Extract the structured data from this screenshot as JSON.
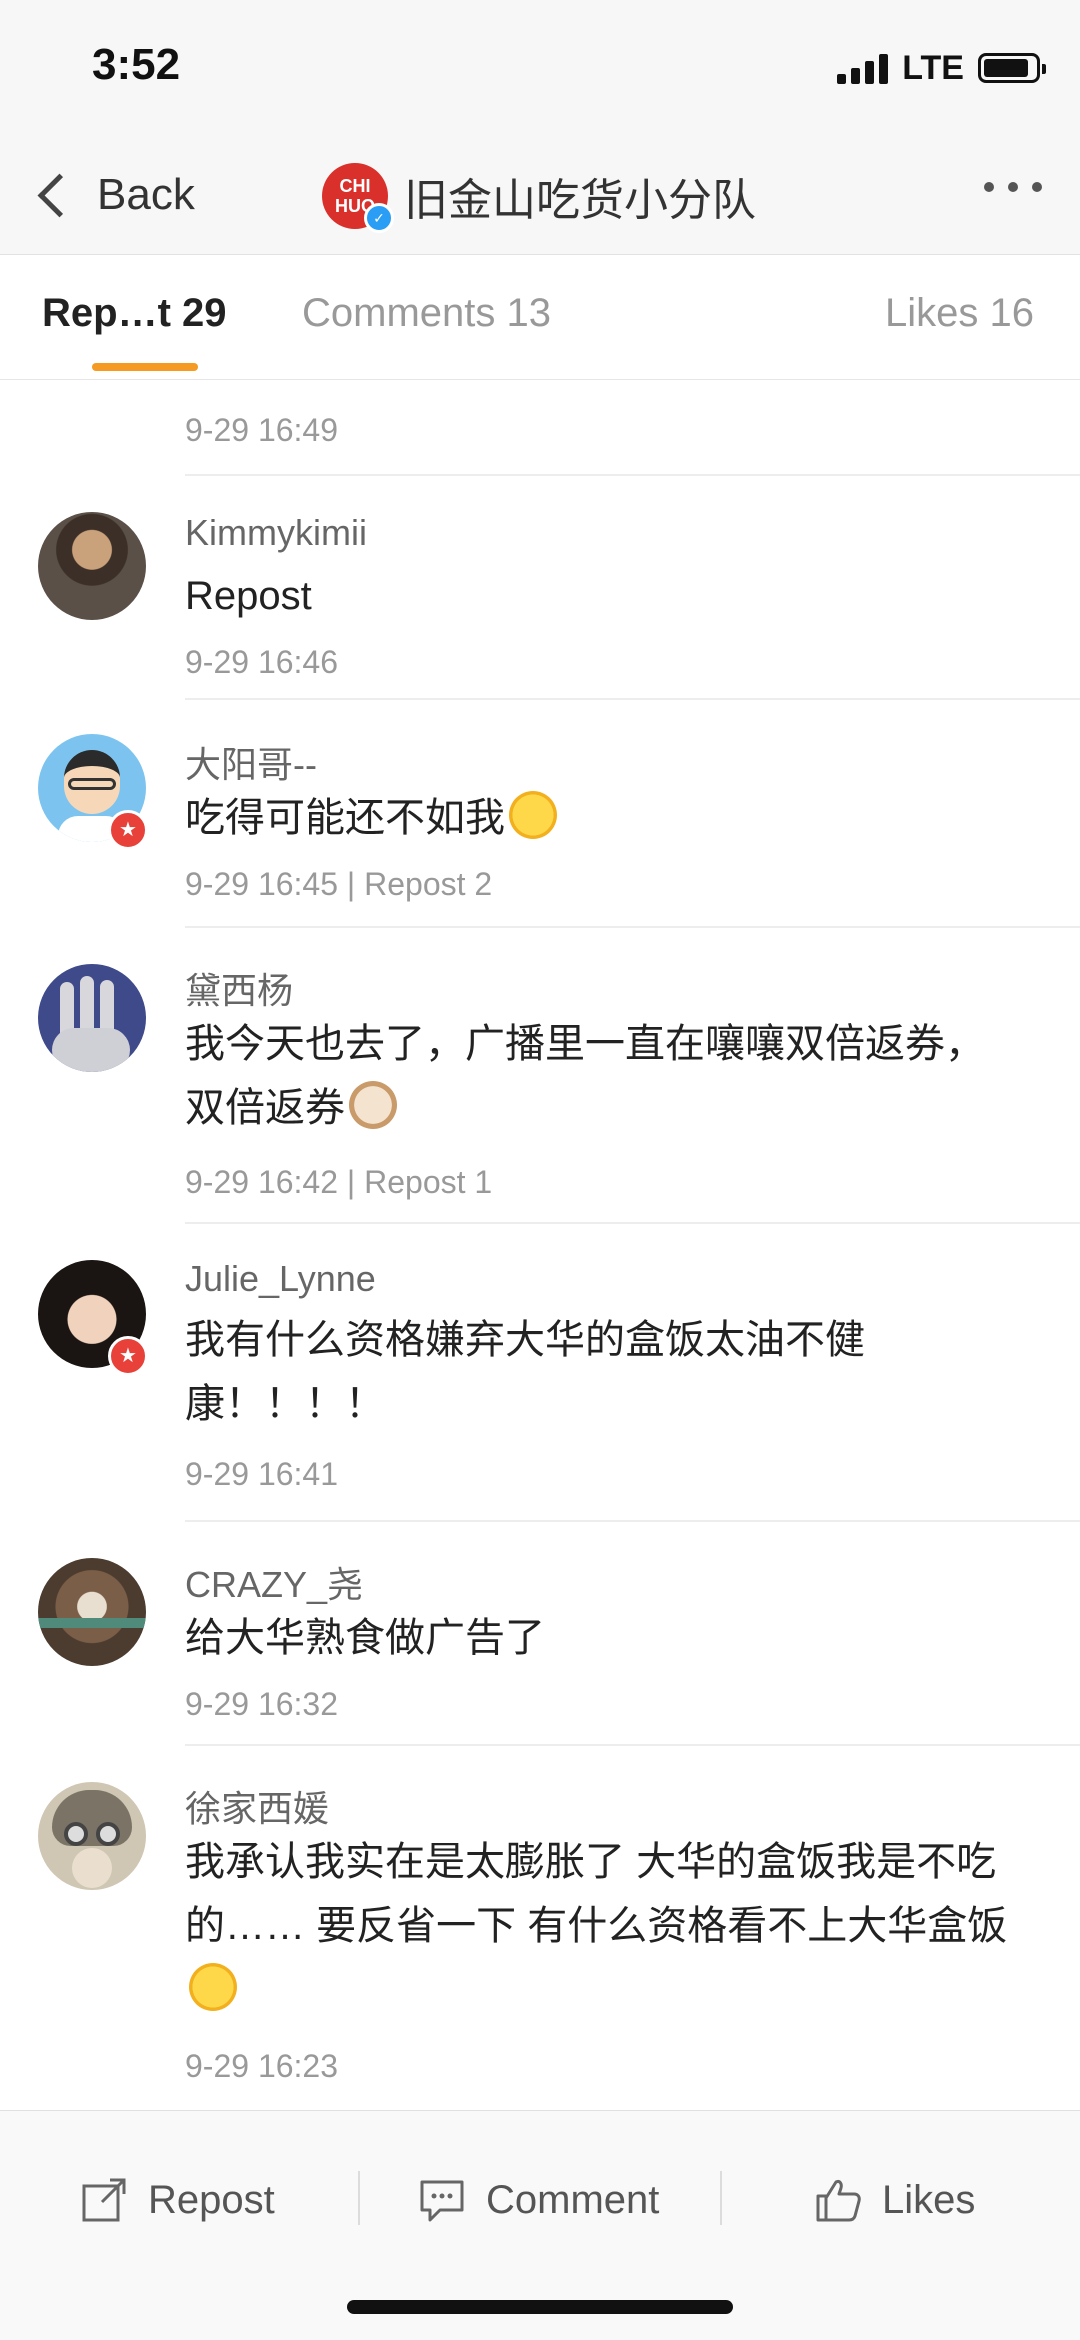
{
  "status": {
    "time": "3:52",
    "network": "LTE"
  },
  "nav": {
    "back_label": "Back",
    "avatar_text": "CHI HUO",
    "title": "旧金山吃货小分队",
    "more_icon": "more-icon"
  },
  "tabs": [
    {
      "label": "Rep…t 29",
      "active": true
    },
    {
      "label": "Comments 13",
      "active": false
    },
    {
      "label": "Likes 16",
      "active": false
    }
  ],
  "top_row_meta": "9-29 16:49",
  "reposts": [
    {
      "user": "Kimmykimii",
      "text": "Repost",
      "meta": "9-29 16:46",
      "verified": false
    },
    {
      "user": "大阳哥--",
      "text": "吃得可能还不如我",
      "emoji": "laughing-tears",
      "meta": "9-29 16:45 | Repost 2",
      "verified": true
    },
    {
      "user": "黛西杨",
      "text": "我今天也去了，广播里一直在嚷嚷双倍返券，双倍返券",
      "emoji": "cat-face",
      "meta": "9-29 16:42 | Repost 1",
      "verified": false
    },
    {
      "user": "Julie_Lynne",
      "text": "我有什么资格嫌弃大华的盒饭太油不健康！！！！",
      "meta": "9-29 16:41",
      "verified": true
    },
    {
      "user": "CRAZY_尧",
      "text": "给大华熟食做广告了",
      "meta": "9-29 16:32",
      "verified": false
    },
    {
      "user": "徐家西媛",
      "text": "我承认我实在是太膨胀了 大华的盒饭我是不吃的…… 要反省一下 有什么资格看不上大华盒饭",
      "emoji": "rolling-laugh",
      "meta": "9-29 16:23",
      "verified": false
    }
  ],
  "actions": {
    "repost": "Repost",
    "comment": "Comment",
    "likes": "Likes"
  },
  "colors": {
    "accent": "#f59a23",
    "badge": "#e8413a",
    "verified": "#2a9df4"
  }
}
